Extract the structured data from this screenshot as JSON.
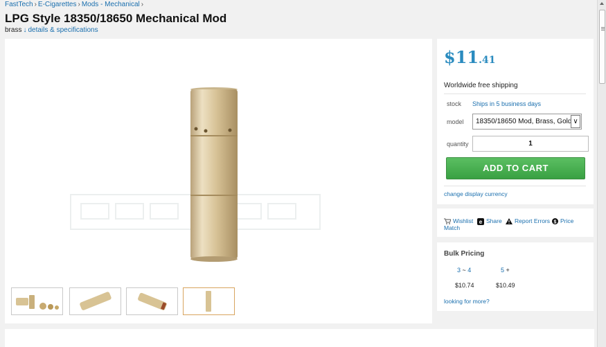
{
  "breadcrumb": {
    "items": [
      "FastTech",
      "E-Cigarettes",
      "Mods - Mechanical"
    ],
    "separator": "›"
  },
  "product": {
    "title": "LPG Style 18350/18650 Mechanical Mod",
    "variant": "brass",
    "details_arrow": "↓",
    "details_link": "details & specifications"
  },
  "purchase": {
    "price_dollars": "$11",
    "price_cents": ".41",
    "shipping": "Worldwide free shipping",
    "stock_label": "stock",
    "stock_value": "Ships in 5 business days",
    "model_label": "model",
    "model_value": "18350/18650 Mod, Brass, Gold",
    "quantity_label": "quantity",
    "quantity_value": "1",
    "add_to_cart": "ADD TO CART",
    "change_currency": "change display currency"
  },
  "actions": {
    "wishlist": "Wishlist",
    "share": "Share",
    "report": "Report Errors",
    "price_match_1": "Price",
    "price_match_2": "Match"
  },
  "bulk": {
    "title": "Bulk Pricing",
    "tiers": [
      {
        "from": "3",
        "sep": " ~ ",
        "to": "4",
        "price": "$10.74"
      },
      {
        "from": "5",
        "sep": " +",
        "to": "",
        "price": "$10.49"
      }
    ],
    "more": "looking for more?"
  },
  "colors": {
    "accent": "#1a6fae",
    "price": "#2a8bbf",
    "cart_button": "#39a042",
    "product_brass": "#d9c49a"
  }
}
